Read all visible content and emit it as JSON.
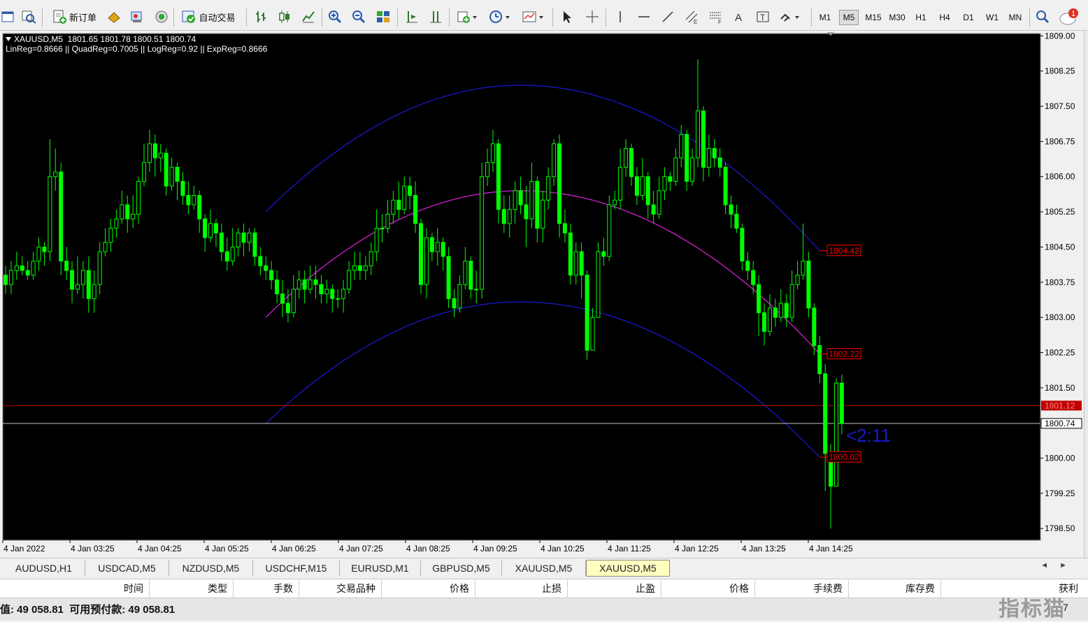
{
  "toolbar": {
    "new_order_label": "新订单",
    "auto_trading_label": "自动交易",
    "notification_count": "1",
    "timeframes": [
      "M1",
      "M5",
      "M15",
      "M30",
      "H1",
      "H4",
      "D1",
      "W1",
      "MN"
    ],
    "active_timeframe": "M5"
  },
  "chart": {
    "symbol_header": "XAUUSD,M5  1801.65 1801.78 1800.51 1800.74",
    "regression_info": "LinReg=0.8666 || QuadReg=0.7005 || LogReg=0.92 || ExpReg=0.8666",
    "countdown_label": "<2:11",
    "colors": {
      "background": "#000000",
      "bull_candle": "#00ff00",
      "bear_candle": "#00ff00",
      "upper_channel": "#1a1ad6",
      "lower_channel": "#1a1ad6",
      "mid_curve": "#e020e0",
      "bid_line": "#c00000",
      "current_line": "#c0c0c0",
      "level_label": "#ff0000",
      "countdown": "#1a1acc"
    }
  },
  "chart_data": {
    "type": "candlestick",
    "symbol": "XAUUSD",
    "timeframe": "M5",
    "ylim": [
      1798.25,
      1809.05
    ],
    "y_ticks": [
      "1809.00",
      "1808.25",
      "1807.50",
      "1806.75",
      "1806.00",
      "1805.25",
      "1804.50",
      "1803.75",
      "1803.00",
      "1802.25",
      "1801.50",
      "1800.74",
      "1800.00",
      "1799.25",
      "1798.50"
    ],
    "x_ticks": [
      "4 Jan 2022",
      "4 Jan 03:25",
      "4 Jan 04:25",
      "4 Jan 05:25",
      "4 Jan 06:25",
      "4 Jan 07:25",
      "4 Jan 08:25",
      "4 Jan 09:25",
      "4 Jan 10:25",
      "4 Jan 11:25",
      "4 Jan 12:25",
      "4 Jan 13:25",
      "4 Jan 14:25"
    ],
    "bid_price": "1801.12",
    "current_price": "1800.74",
    "channel_labels": [
      "1804.42",
      "1802.22",
      "1800.02"
    ],
    "channel": {
      "start_index": 47,
      "end_index": 147,
      "upper": {
        "start": 1805.25,
        "peak": 1807.95,
        "peak_index": 93,
        "end": 1804.42
      },
      "mid": {
        "start": 1803.0,
        "peak": 1805.7,
        "peak_index": 93,
        "end": 1802.22
      },
      "lower": {
        "start": 1800.74,
        "peak": 1803.33,
        "peak_index": 93,
        "end": 1800.02
      }
    },
    "candles": [
      [
        1803.9,
        1803.7,
        1804.1,
        1803.5
      ],
      [
        1803.7,
        1804.0,
        1804.2,
        1803.5
      ],
      [
        1804.0,
        1804.1,
        1804.4,
        1803.8
      ],
      [
        1804.1,
        1804.0,
        1804.3,
        1803.9
      ],
      [
        1804.0,
        1803.9,
        1804.2,
        1803.8
      ],
      [
        1803.9,
        1804.2,
        1804.4,
        1803.8
      ],
      [
        1804.2,
        1804.5,
        1804.7,
        1804.0
      ],
      [
        1804.5,
        1804.4,
        1804.6,
        1804.1
      ],
      [
        1804.4,
        1806.0,
        1806.8,
        1804.2
      ],
      [
        1806.0,
        1806.1,
        1806.6,
        1805.7
      ],
      [
        1806.1,
        1804.2,
        1806.3,
        1803.9
      ],
      [
        1804.2,
        1804.0,
        1804.5,
        1803.8
      ],
      [
        1804.0,
        1803.6,
        1804.2,
        1803.3
      ],
      [
        1803.6,
        1803.7,
        1804.3,
        1803.5
      ],
      [
        1803.7,
        1804.0,
        1804.2,
        1803.4
      ],
      [
        1804.0,
        1803.4,
        1804.3,
        1803.1
      ],
      [
        1803.4,
        1803.7,
        1804.0,
        1803.1
      ],
      [
        1803.7,
        1804.4,
        1804.6,
        1803.5
      ],
      [
        1804.4,
        1804.6,
        1804.9,
        1804.3
      ],
      [
        1804.6,
        1804.9,
        1805.1,
        1804.4
      ],
      [
        1804.9,
        1805.1,
        1805.3,
        1804.7
      ],
      [
        1805.1,
        1805.4,
        1805.7,
        1805.0
      ],
      [
        1805.4,
        1805.1,
        1805.6,
        1804.8
      ],
      [
        1805.1,
        1805.2,
        1805.6,
        1804.9
      ],
      [
        1805.2,
        1805.9,
        1806.0,
        1805.0
      ],
      [
        1805.9,
        1806.3,
        1806.7,
        1805.8
      ],
      [
        1806.3,
        1806.7,
        1807.0,
        1806.1
      ],
      [
        1806.7,
        1806.4,
        1806.9,
        1806.0
      ],
      [
        1806.4,
        1806.5,
        1806.7,
        1806.1
      ],
      [
        1806.5,
        1805.8,
        1806.6,
        1805.6
      ],
      [
        1805.8,
        1806.2,
        1806.4,
        1805.7
      ],
      [
        1806.2,
        1805.9,
        1806.3,
        1805.5
      ],
      [
        1805.9,
        1805.6,
        1806.1,
        1805.4
      ],
      [
        1805.6,
        1805.4,
        1805.9,
        1805.2
      ],
      [
        1805.4,
        1805.6,
        1805.8,
        1805.3
      ],
      [
        1805.6,
        1805.1,
        1805.7,
        1804.8
      ],
      [
        1805.1,
        1804.7,
        1805.2,
        1804.4
      ],
      [
        1804.7,
        1805.0,
        1805.3,
        1804.6
      ],
      [
        1805.0,
        1804.8,
        1805.1,
        1804.5
      ],
      [
        1804.8,
        1804.4,
        1805.0,
        1804.2
      ],
      [
        1804.4,
        1804.2,
        1804.7,
        1804.0
      ],
      [
        1804.2,
        1804.5,
        1804.9,
        1804.1
      ],
      [
        1804.5,
        1804.8,
        1804.9,
        1804.3
      ],
      [
        1804.8,
        1804.6,
        1805.0,
        1804.3
      ],
      [
        1804.6,
        1804.8,
        1804.9,
        1804.4
      ],
      [
        1804.8,
        1804.3,
        1804.9,
        1804.1
      ],
      [
        1804.3,
        1804.1,
        1804.5,
        1803.9
      ],
      [
        1804.1,
        1804.0,
        1804.3,
        1803.8
      ],
      [
        1804.0,
        1803.8,
        1804.2,
        1803.6
      ],
      [
        1803.8,
        1803.5,
        1804.0,
        1803.3
      ],
      [
        1803.5,
        1803.3,
        1803.8,
        1803.0
      ],
      [
        1803.3,
        1803.1,
        1803.6,
        1802.9
      ],
      [
        1803.1,
        1803.6,
        1803.9,
        1803.0
      ],
      [
        1803.6,
        1803.8,
        1804.0,
        1803.4
      ],
      [
        1803.8,
        1803.6,
        1804.0,
        1803.3
      ],
      [
        1803.6,
        1803.8,
        1804.1,
        1803.5
      ],
      [
        1803.8,
        1803.7,
        1804.1,
        1803.4
      ],
      [
        1803.7,
        1803.5,
        1803.9,
        1803.3
      ],
      [
        1803.5,
        1803.6,
        1803.8,
        1803.3
      ],
      [
        1803.6,
        1803.4,
        1803.7,
        1803.1
      ],
      [
        1803.4,
        1803.4,
        1803.6,
        1803.2
      ],
      [
        1803.4,
        1803.6,
        1803.8,
        1803.1
      ],
      [
        1803.6,
        1804.0,
        1804.2,
        1803.5
      ],
      [
        1804.0,
        1804.1,
        1804.4,
        1803.8
      ],
      [
        1804.1,
        1804.0,
        1804.4,
        1803.8
      ],
      [
        1804.0,
        1804.1,
        1804.3,
        1803.8
      ],
      [
        1804.1,
        1804.4,
        1804.6,
        1803.9
      ],
      [
        1804.4,
        1804.9,
        1805.3,
        1804.2
      ],
      [
        1804.9,
        1804.9,
        1805.2,
        1804.6
      ],
      [
        1804.9,
        1805.2,
        1805.5,
        1804.8
      ],
      [
        1805.2,
        1805.5,
        1805.7,
        1805.0
      ],
      [
        1805.5,
        1805.3,
        1805.9,
        1805.1
      ],
      [
        1805.3,
        1805.8,
        1806.0,
        1805.2
      ],
      [
        1805.8,
        1805.6,
        1806.0,
        1805.3
      ],
      [
        1805.6,
        1805.0,
        1805.9,
        1804.8
      ],
      [
        1805.0,
        1803.7,
        1805.1,
        1803.5
      ],
      [
        1803.7,
        1804.7,
        1804.9,
        1803.4
      ],
      [
        1804.7,
        1804.4,
        1804.8,
        1804.2
      ],
      [
        1804.4,
        1804.6,
        1804.9,
        1804.1
      ],
      [
        1804.6,
        1804.3,
        1804.7,
        1804.0
      ],
      [
        1804.3,
        1803.4,
        1804.5,
        1803.2
      ],
      [
        1803.4,
        1803.2,
        1803.6,
        1803.0
      ],
      [
        1803.2,
        1803.7,
        1803.9,
        1803.1
      ],
      [
        1803.7,
        1804.2,
        1804.5,
        1803.6
      ],
      [
        1804.2,
        1803.6,
        1804.3,
        1803.4
      ],
      [
        1803.6,
        1803.6,
        1804.0,
        1803.3
      ],
      [
        1803.6,
        1806.0,
        1806.3,
        1803.4
      ],
      [
        1806.0,
        1806.3,
        1806.6,
        1805.8
      ],
      [
        1806.3,
        1806.7,
        1807.0,
        1806.1
      ],
      [
        1806.7,
        1805.3,
        1806.8,
        1805.0
      ],
      [
        1805.3,
        1805.0,
        1805.6,
        1804.8
      ],
      [
        1805.0,
        1805.3,
        1805.6,
        1804.7
      ],
      [
        1805.3,
        1805.7,
        1805.9,
        1805.0
      ],
      [
        1805.7,
        1805.4,
        1806.0,
        1805.2
      ],
      [
        1805.4,
        1805.1,
        1805.8,
        1804.5
      ],
      [
        1805.1,
        1805.9,
        1806.3,
        1804.9
      ],
      [
        1805.9,
        1804.9,
        1806.0,
        1804.6
      ],
      [
        1804.9,
        1805.5,
        1805.7,
        1804.6
      ],
      [
        1805.5,
        1806.0,
        1806.2,
        1805.3
      ],
      [
        1806.0,
        1806.7,
        1806.8,
        1805.8
      ],
      [
        1806.7,
        1805.0,
        1806.9,
        1804.7
      ],
      [
        1805.0,
        1804.8,
        1805.3,
        1804.6
      ],
      [
        1804.8,
        1803.9,
        1805.0,
        1803.7
      ],
      [
        1803.9,
        1804.4,
        1804.6,
        1803.7
      ],
      [
        1804.4,
        1803.9,
        1804.6,
        1803.4
      ],
      [
        1803.9,
        1802.3,
        1804.0,
        1802.1
      ],
      [
        1802.3,
        1803.0,
        1803.2,
        1802.3
      ],
      [
        1803.0,
        1804.4,
        1804.6,
        1803.1
      ],
      [
        1804.4,
        1804.3,
        1804.7,
        1804.1
      ],
      [
        1804.3,
        1805.4,
        1805.6,
        1804.2
      ],
      [
        1805.4,
        1805.5,
        1805.7,
        1805.3
      ],
      [
        1805.5,
        1806.2,
        1806.6,
        1805.3
      ],
      [
        1806.2,
        1806.6,
        1806.8,
        1806.0
      ],
      [
        1806.6,
        1806.0,
        1806.7,
        1805.8
      ],
      [
        1806.0,
        1805.6,
        1806.2,
        1805.4
      ],
      [
        1805.6,
        1806.0,
        1806.4,
        1805.5
      ],
      [
        1806.0,
        1805.4,
        1806.1,
        1805.1
      ],
      [
        1805.4,
        1805.2,
        1805.7,
        1805.0
      ],
      [
        1805.2,
        1805.7,
        1806.0,
        1805.1
      ],
      [
        1805.7,
        1806.0,
        1806.2,
        1805.5
      ],
      [
        1806.0,
        1805.9,
        1806.1,
        1805.7
      ],
      [
        1805.9,
        1806.4,
        1806.6,
        1805.8
      ],
      [
        1806.4,
        1806.9,
        1807.1,
        1806.2
      ],
      [
        1806.9,
        1805.9,
        1807.0,
        1805.7
      ],
      [
        1805.9,
        1806.4,
        1806.6,
        1805.8
      ],
      [
        1806.4,
        1807.4,
        1808.5,
        1806.2
      ],
      [
        1807.4,
        1806.2,
        1807.5,
        1805.9
      ],
      [
        1806.2,
        1806.6,
        1806.9,
        1806.0
      ],
      [
        1806.6,
        1806.4,
        1806.8,
        1806.2
      ],
      [
        1806.4,
        1806.2,
        1806.6,
        1806.0
      ],
      [
        1806.2,
        1805.4,
        1806.3,
        1805.2
      ],
      [
        1805.4,
        1805.2,
        1805.6,
        1804.9
      ],
      [
        1805.2,
        1804.9,
        1805.4,
        1804.8
      ],
      [
        1804.9,
        1804.2,
        1805.0,
        1804.0
      ],
      [
        1804.2,
        1804.0,
        1804.4,
        1803.8
      ],
      [
        1804.0,
        1803.7,
        1804.2,
        1803.5
      ],
      [
        1803.7,
        1803.1,
        1803.9,
        1802.6
      ],
      [
        1803.1,
        1802.7,
        1803.3,
        1802.4
      ],
      [
        1802.7,
        1803.2,
        1803.5,
        1802.6
      ],
      [
        1803.2,
        1803.0,
        1803.4,
        1802.8
      ],
      [
        1803.0,
        1803.3,
        1803.6,
        1802.9
      ],
      [
        1803.3,
        1803.0,
        1803.5,
        1802.8
      ],
      [
        1803.0,
        1803.7,
        1804.0,
        1802.9
      ],
      [
        1803.7,
        1803.9,
        1804.2,
        1803.6
      ],
      [
        1803.9,
        1804.2,
        1805.0,
        1803.8
      ],
      [
        1804.2,
        1803.2,
        1804.4,
        1803.0
      ],
      [
        1803.2,
        1802.4,
        1803.3,
        1802.2
      ],
      [
        1802.4,
        1801.8,
        1802.6,
        1801.6
      ],
      [
        1801.8,
        1800.1,
        1802.0,
        1799.3
      ],
      [
        1800.1,
        1799.4,
        1800.3,
        1798.5
      ],
      [
        1799.4,
        1801.6,
        1801.7,
        1799.4
      ],
      [
        1801.6,
        1800.74,
        1801.78,
        1800.51
      ]
    ]
  },
  "tabs": [
    "AUDUSD,H1",
    "USDCAD,M5",
    "NZDUSD,M5",
    "USDCHF,M15",
    "EURUSD,M1",
    "GBPUSD,M5",
    "XAUUSD,M5",
    "XAUUSD,M5"
  ],
  "active_tab_index": 7,
  "terminal": {
    "columns": [
      "时间",
      "类型",
      "手数",
      "交易品种",
      "价格",
      "止损",
      "止盈",
      "价格",
      "手续费",
      "库存费",
      "获利"
    ],
    "status": "值: 49 058.81  可用预付款: 49 058.81",
    "status_right": "7"
  },
  "watermark": "指标猫"
}
